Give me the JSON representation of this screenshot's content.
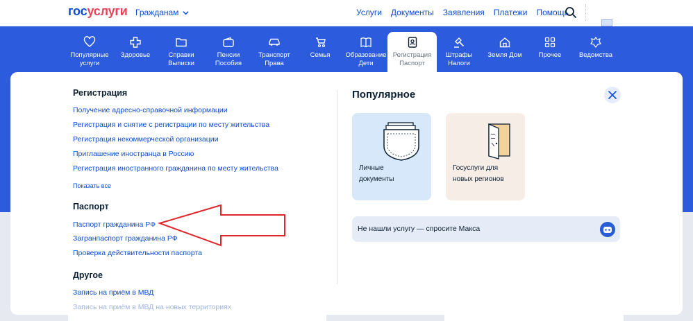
{
  "header": {
    "logo": {
      "part1": "гос",
      "part2": "услуги"
    },
    "audience": "Гражданам",
    "nav": [
      "Услуги",
      "Документы",
      "Заявления",
      "Платежи",
      "Помощь"
    ],
    "icons": {
      "search": "search-icon",
      "audience_chevron": "chevron-down-icon"
    }
  },
  "categories": [
    {
      "label": "Популярные\nуслуги",
      "icon": "heart-icon"
    },
    {
      "label": "Здоровье",
      "icon": "health-cross-icon"
    },
    {
      "label": "Справки\nВыписки",
      "icon": "folder-icon"
    },
    {
      "label": "Пенсии\nПособия",
      "icon": "wallet-icon"
    },
    {
      "label": "Транспорт\nПрава",
      "icon": "car-icon"
    },
    {
      "label": "Семья",
      "icon": "stroller-icon"
    },
    {
      "label": "Образование\nДети",
      "icon": "book-icon"
    },
    {
      "label": "Регистрация\nПаспорт",
      "icon": "passport-icon",
      "active": true
    },
    {
      "label": "Штрафы\nНалоги",
      "icon": "gavel-icon"
    },
    {
      "label": "Земля Дом",
      "icon": "house-icon"
    },
    {
      "label": "Прочее",
      "icon": "grid-icon"
    },
    {
      "label": "Ведомства",
      "icon": "emblem-icon"
    }
  ],
  "menu": {
    "registration": {
      "title": "Регистрация",
      "links": [
        "Получение адресно-справочной информации",
        "Регистрация и снятие с регистрации по месту жительства",
        "Регистрация некоммерческой организации",
        "Приглашение иностранца в Россию",
        "Регистрация иностранного гражданина по месту жительства"
      ],
      "show_all": "Показать все"
    },
    "passport": {
      "title": "Паспорт",
      "links": [
        "Паспорт гражданина РФ",
        "Загранпаспорт гражданина РФ",
        "Проверка действительности паспорта"
      ]
    },
    "other": {
      "title": "Другое",
      "links": [
        "Запись на приём в МВД",
        "Запись на приём в МВД на новых территориях"
      ]
    }
  },
  "popular": {
    "title": "Популярное",
    "tiles": [
      {
        "label": "Личные\nдокументы",
        "icon": "documents-pocket-icon"
      },
      {
        "label": "Госуслуги для\nновых регионов",
        "icon": "doors-icon"
      }
    ],
    "ask": "Не нашли услугу — спросите Макса",
    "ask_icon": "robot-max-icon",
    "close_icon": "close-icon"
  },
  "colors": {
    "brand_blue": "#0d4cd3",
    "band_blue": "#2d5bde",
    "brand_red": "#ee3f58",
    "annotation_arrow": "#e0262b"
  }
}
